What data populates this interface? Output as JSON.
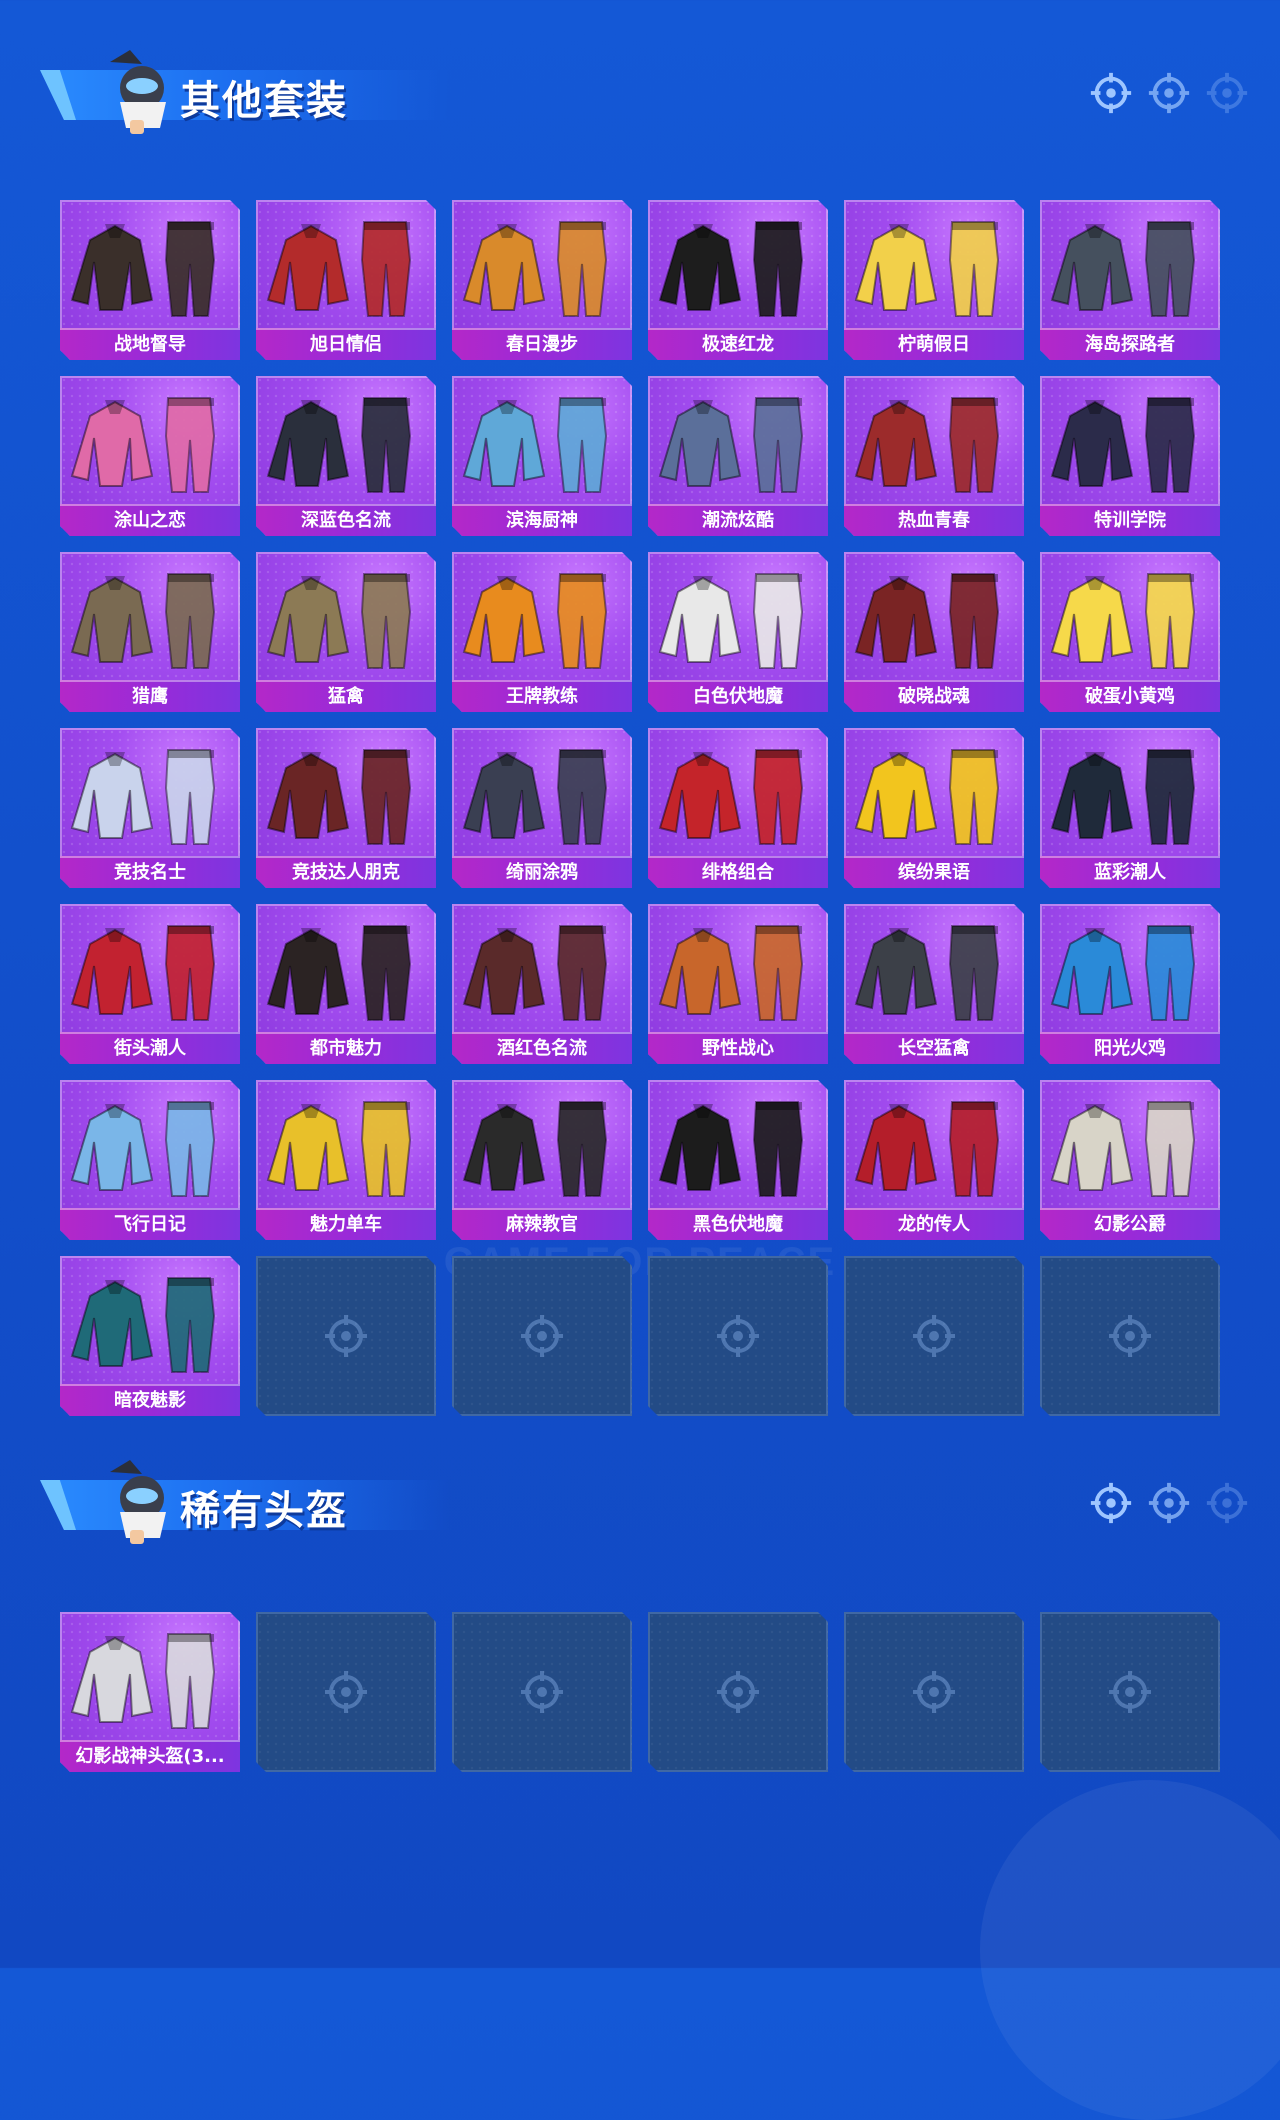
{
  "sections": [
    {
      "title": "其他套装",
      "items": [
        {
          "name": "战地督导",
          "hue": "#3a2f2a"
        },
        {
          "name": "旭日情侣",
          "hue": "#b32b2b"
        },
        {
          "name": "春日漫步",
          "hue": "#d98a2b"
        },
        {
          "name": "极速红龙",
          "hue": "#1d1d1d"
        },
        {
          "name": "柠萌假日",
          "hue": "#f2d04a"
        },
        {
          "name": "海岛探路者",
          "hue": "#45505e"
        },
        {
          "name": "涂山之恋",
          "hue": "#e06aa8"
        },
        {
          "name": "深蓝色名流",
          "hue": "#2a2f3c"
        },
        {
          "name": "滨海厨神",
          "hue": "#5fa8d8"
        },
        {
          "name": "潮流炫酷",
          "hue": "#5b6f9a"
        },
        {
          "name": "热血青春",
          "hue": "#9c2b2b"
        },
        {
          "name": "特训学院",
          "hue": "#2b2b4a"
        },
        {
          "name": "猎鹰",
          "hue": "#7a6a52"
        },
        {
          "name": "猛禽",
          "hue": "#8c7a55"
        },
        {
          "name": "王牌教练",
          "hue": "#e88b1e"
        },
        {
          "name": "白色伏地魔",
          "hue": "#e8e8e8"
        },
        {
          "name": "破晓战魂",
          "hue": "#7a2424"
        },
        {
          "name": "破蛋小黄鸡",
          "hue": "#f6d94a"
        },
        {
          "name": "竞技名士",
          "hue": "#c9d3ec"
        },
        {
          "name": "竞技达人朋克",
          "hue": "#6a2525"
        },
        {
          "name": "绮丽涂鸦",
          "hue": "#3a3f52"
        },
        {
          "name": "绯格组合",
          "hue": "#c4242a"
        },
        {
          "name": "缤纷果语",
          "hue": "#f2c51e"
        },
        {
          "name": "蓝彩潮人",
          "hue": "#1f2a3a"
        },
        {
          "name": "街头潮人",
          "hue": "#c22230"
        },
        {
          "name": "都市魅力",
          "hue": "#2b2323"
        },
        {
          "name": "酒红色名流",
          "hue": "#5a2a2a"
        },
        {
          "name": "野性战心",
          "hue": "#c8662b"
        },
        {
          "name": "长空猛禽",
          "hue": "#3c4048"
        },
        {
          "name": "阳光火鸡",
          "hue": "#2a8ad8"
        },
        {
          "name": "飞行日记",
          "hue": "#7ab6e8"
        },
        {
          "name": "魅力单车",
          "hue": "#e8c02a"
        },
        {
          "name": "麻辣教官",
          "hue": "#2a2a2a"
        },
        {
          "name": "黑色伏地魔",
          "hue": "#1c1c1c"
        },
        {
          "name": "龙的传人",
          "hue": "#b41e2a"
        },
        {
          "name": "幻影公爵",
          "hue": "#d8d4c8"
        },
        {
          "name": "暗夜魅影",
          "hue": "#1f6a78"
        }
      ],
      "empty_slots": 5
    },
    {
      "title": "稀有头盔",
      "items": [
        {
          "name": "幻影战神头盔(3...",
          "hue": "#d8d8de"
        }
      ],
      "empty_slots": 5
    }
  ],
  "watermark": "GAME FOR PEACE"
}
